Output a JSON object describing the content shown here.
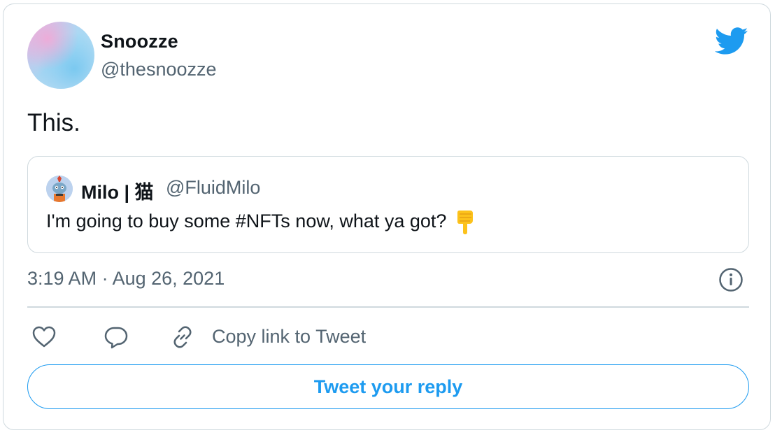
{
  "author": {
    "display_name": "Snoozze",
    "handle": "@thesnoozze"
  },
  "tweet": {
    "text": "This."
  },
  "quoted_tweet": {
    "display_name": "Milo | 猫",
    "handle": "@FluidMilo",
    "text": "I'm going to buy some #NFTs now, what ya got?",
    "emoji": "backhand-index-pointing-down"
  },
  "timestamp": "3:19 AM · Aug 26, 2021",
  "actions": {
    "copy_link_label": "Copy link to Tweet",
    "reply_button_label": "Tweet your reply"
  },
  "icons": {
    "brand": "twitter-bird-icon",
    "info": "info-icon",
    "like": "heart-icon",
    "reply": "comment-icon",
    "link": "link-icon"
  },
  "colors": {
    "brand_blue": "#1d9bf0",
    "text_primary": "#0f1419",
    "text_secondary": "#536471",
    "border": "#cfd9de"
  }
}
